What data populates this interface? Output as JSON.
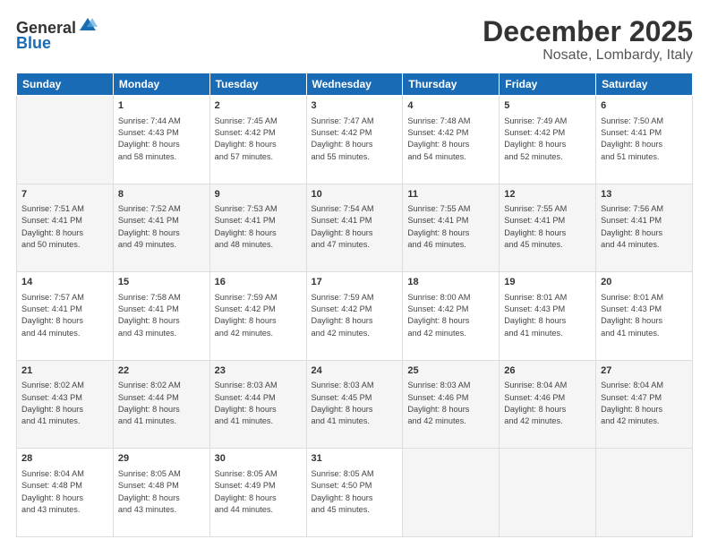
{
  "header": {
    "logo_general": "General",
    "logo_blue": "Blue",
    "month": "December 2025",
    "location": "Nosate, Lombardy, Italy"
  },
  "days_of_week": [
    "Sunday",
    "Monday",
    "Tuesday",
    "Wednesday",
    "Thursday",
    "Friday",
    "Saturday"
  ],
  "weeks": [
    [
      {
        "day": "",
        "info": ""
      },
      {
        "day": "1",
        "info": "Sunrise: 7:44 AM\nSunset: 4:43 PM\nDaylight: 8 hours\nand 58 minutes."
      },
      {
        "day": "2",
        "info": "Sunrise: 7:45 AM\nSunset: 4:42 PM\nDaylight: 8 hours\nand 57 minutes."
      },
      {
        "day": "3",
        "info": "Sunrise: 7:47 AM\nSunset: 4:42 PM\nDaylight: 8 hours\nand 55 minutes."
      },
      {
        "day": "4",
        "info": "Sunrise: 7:48 AM\nSunset: 4:42 PM\nDaylight: 8 hours\nand 54 minutes."
      },
      {
        "day": "5",
        "info": "Sunrise: 7:49 AM\nSunset: 4:42 PM\nDaylight: 8 hours\nand 52 minutes."
      },
      {
        "day": "6",
        "info": "Sunrise: 7:50 AM\nSunset: 4:41 PM\nDaylight: 8 hours\nand 51 minutes."
      }
    ],
    [
      {
        "day": "7",
        "info": "Sunrise: 7:51 AM\nSunset: 4:41 PM\nDaylight: 8 hours\nand 50 minutes."
      },
      {
        "day": "8",
        "info": "Sunrise: 7:52 AM\nSunset: 4:41 PM\nDaylight: 8 hours\nand 49 minutes."
      },
      {
        "day": "9",
        "info": "Sunrise: 7:53 AM\nSunset: 4:41 PM\nDaylight: 8 hours\nand 48 minutes."
      },
      {
        "day": "10",
        "info": "Sunrise: 7:54 AM\nSunset: 4:41 PM\nDaylight: 8 hours\nand 47 minutes."
      },
      {
        "day": "11",
        "info": "Sunrise: 7:55 AM\nSunset: 4:41 PM\nDaylight: 8 hours\nand 46 minutes."
      },
      {
        "day": "12",
        "info": "Sunrise: 7:55 AM\nSunset: 4:41 PM\nDaylight: 8 hours\nand 45 minutes."
      },
      {
        "day": "13",
        "info": "Sunrise: 7:56 AM\nSunset: 4:41 PM\nDaylight: 8 hours\nand 44 minutes."
      }
    ],
    [
      {
        "day": "14",
        "info": "Sunrise: 7:57 AM\nSunset: 4:41 PM\nDaylight: 8 hours\nand 44 minutes."
      },
      {
        "day": "15",
        "info": "Sunrise: 7:58 AM\nSunset: 4:41 PM\nDaylight: 8 hours\nand 43 minutes."
      },
      {
        "day": "16",
        "info": "Sunrise: 7:59 AM\nSunset: 4:42 PM\nDaylight: 8 hours\nand 42 minutes."
      },
      {
        "day": "17",
        "info": "Sunrise: 7:59 AM\nSunset: 4:42 PM\nDaylight: 8 hours\nand 42 minutes."
      },
      {
        "day": "18",
        "info": "Sunrise: 8:00 AM\nSunset: 4:42 PM\nDaylight: 8 hours\nand 42 minutes."
      },
      {
        "day": "19",
        "info": "Sunrise: 8:01 AM\nSunset: 4:43 PM\nDaylight: 8 hours\nand 41 minutes."
      },
      {
        "day": "20",
        "info": "Sunrise: 8:01 AM\nSunset: 4:43 PM\nDaylight: 8 hours\nand 41 minutes."
      }
    ],
    [
      {
        "day": "21",
        "info": "Sunrise: 8:02 AM\nSunset: 4:43 PM\nDaylight: 8 hours\nand 41 minutes."
      },
      {
        "day": "22",
        "info": "Sunrise: 8:02 AM\nSunset: 4:44 PM\nDaylight: 8 hours\nand 41 minutes."
      },
      {
        "day": "23",
        "info": "Sunrise: 8:03 AM\nSunset: 4:44 PM\nDaylight: 8 hours\nand 41 minutes."
      },
      {
        "day": "24",
        "info": "Sunrise: 8:03 AM\nSunset: 4:45 PM\nDaylight: 8 hours\nand 41 minutes."
      },
      {
        "day": "25",
        "info": "Sunrise: 8:03 AM\nSunset: 4:46 PM\nDaylight: 8 hours\nand 42 minutes."
      },
      {
        "day": "26",
        "info": "Sunrise: 8:04 AM\nSunset: 4:46 PM\nDaylight: 8 hours\nand 42 minutes."
      },
      {
        "day": "27",
        "info": "Sunrise: 8:04 AM\nSunset: 4:47 PM\nDaylight: 8 hours\nand 42 minutes."
      }
    ],
    [
      {
        "day": "28",
        "info": "Sunrise: 8:04 AM\nSunset: 4:48 PM\nDaylight: 8 hours\nand 43 minutes."
      },
      {
        "day": "29",
        "info": "Sunrise: 8:05 AM\nSunset: 4:48 PM\nDaylight: 8 hours\nand 43 minutes."
      },
      {
        "day": "30",
        "info": "Sunrise: 8:05 AM\nSunset: 4:49 PM\nDaylight: 8 hours\nand 44 minutes."
      },
      {
        "day": "31",
        "info": "Sunrise: 8:05 AM\nSunset: 4:50 PM\nDaylight: 8 hours\nand 45 minutes."
      },
      {
        "day": "",
        "info": ""
      },
      {
        "day": "",
        "info": ""
      },
      {
        "day": "",
        "info": ""
      }
    ]
  ]
}
